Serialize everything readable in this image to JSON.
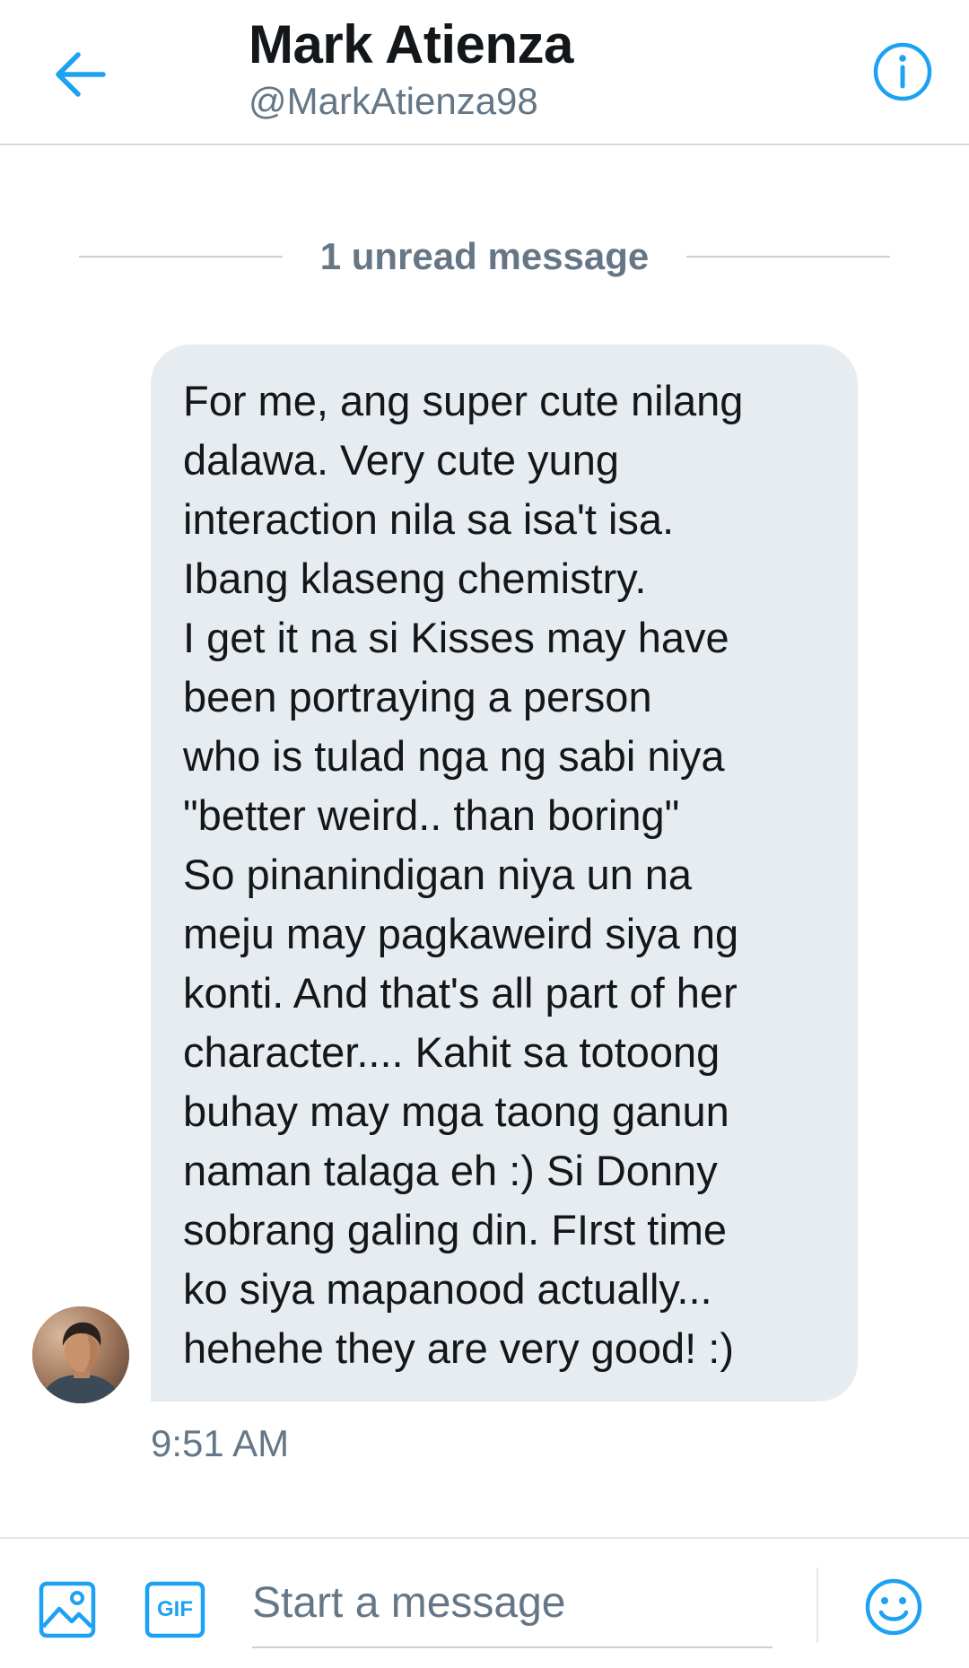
{
  "header": {
    "name": "Mark Atienza",
    "handle": "@MarkAtienza98",
    "back_icon": "arrow-left-icon",
    "info_icon": "info-icon"
  },
  "unread_divider": {
    "text": "1 unread message"
  },
  "message": {
    "lines": [
      "For me, ang super cute nilang",
      "dalawa. Very cute yung",
      "interaction nila sa isa't isa.",
      "Ibang klaseng chemistry.",
      "I get it na si Kisses may have",
      "been portraying a person",
      "who is tulad nga ng sabi niya",
      "\"better weird.. than boring\"",
      "So pinanindigan niya un na",
      "meju may pagkaweird siya ng",
      "konti. And that's all part of her",
      "character.... Kahit sa totoong",
      "buhay may mga taong ganun",
      "naman talaga eh :) Si Donny",
      "sobrang galing din. FIrst time",
      "ko siya mapanood actually...",
      "hehehe they are very good! :)"
    ],
    "timestamp": "9:51 AM"
  },
  "composer": {
    "placeholder": "Start a message",
    "value": "",
    "media_icon": "image-icon",
    "gif_label": "GIF",
    "emoji_icon": "emoji-icon"
  },
  "colors": {
    "accent": "#1da1f2",
    "bubble": "#e6ecf0",
    "text_primary": "#14171a",
    "text_secondary": "#657786"
  }
}
